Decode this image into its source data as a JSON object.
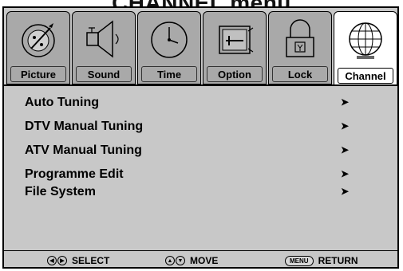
{
  "title": "CHANNEL menu",
  "tabs": [
    {
      "label": "Picture",
      "icon": "picture-icon",
      "active": false
    },
    {
      "label": "Sound",
      "icon": "speaker-icon",
      "active": false
    },
    {
      "label": "Time",
      "icon": "clock-icon",
      "active": false
    },
    {
      "label": "Option",
      "icon": "option-icon",
      "active": false
    },
    {
      "label": "Lock",
      "icon": "lock-icon",
      "active": false
    },
    {
      "label": "Channel",
      "icon": "globe-icon",
      "active": true
    }
  ],
  "menu": {
    "items": [
      {
        "label": "Auto Tuning"
      },
      {
        "label": "DTV Manual Tuning"
      },
      {
        "label": "ATV Manual Tuning"
      },
      {
        "label": "Programme Edit"
      },
      {
        "label": "File System"
      }
    ],
    "arrow": "➤"
  },
  "footer": {
    "select": "SELECT",
    "move": "MOVE",
    "menu_key": "MENU",
    "return": "RETURN"
  },
  "colors": {
    "panel": "#c8c8c8",
    "tab_inactive": "#a9a9a9",
    "tab_active": "#ffffff"
  }
}
